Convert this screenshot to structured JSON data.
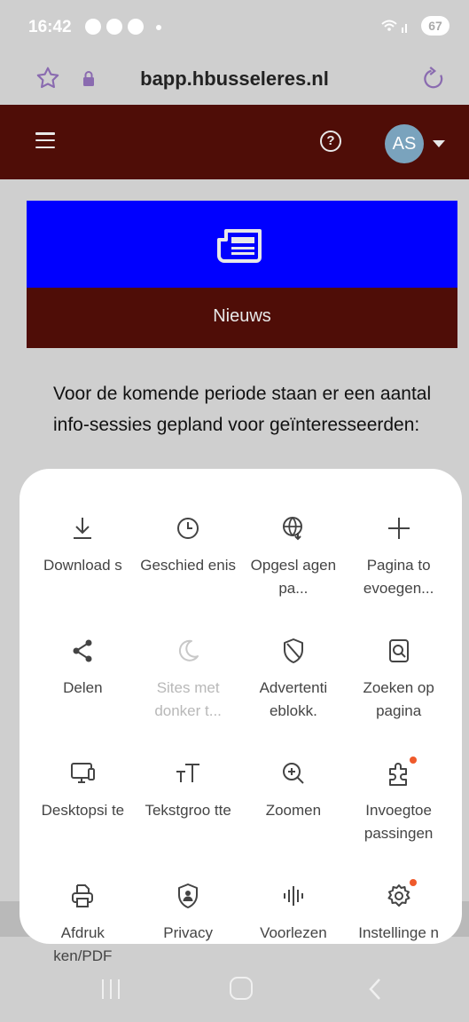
{
  "status": {
    "time": "16:42",
    "battery": "67"
  },
  "browser": {
    "url": "bapp.hbusseleres.nl"
  },
  "header": {
    "avatar_initials": "AS"
  },
  "news": {
    "title": "Nieuws",
    "body": "Voor de komende periode staan er een aantal info-sessies gepland voor geïnteresseerden:"
  },
  "menu": {
    "items": [
      {
        "label": "Download s",
        "icon": "download-icon"
      },
      {
        "label": "Geschied enis",
        "icon": "history-icon"
      },
      {
        "label": "Opgesl agen pa...",
        "icon": "saved-pages-icon"
      },
      {
        "label": "Pagina to evoegen...",
        "icon": "plus-icon"
      },
      {
        "label": "Delen",
        "icon": "share-icon"
      },
      {
        "label": "Sites met donker t...",
        "icon": "moon-icon"
      },
      {
        "label": "Advertenti eblokk.",
        "icon": "shield-icon"
      },
      {
        "label": "Zoeken op pagina",
        "icon": "find-in-page-icon"
      },
      {
        "label": "Desktopsi te",
        "icon": "desktop-icon"
      },
      {
        "label": "Tekstgroo tte",
        "icon": "text-size-icon"
      },
      {
        "label": "Zoomen",
        "icon": "zoom-icon"
      },
      {
        "label": "Invoegtoe passingen",
        "icon": "extensions-icon"
      },
      {
        "label": "Afdruk ken/PDF",
        "icon": "print-icon"
      },
      {
        "label": "Privacy",
        "icon": "privacy-icon"
      },
      {
        "label": "Voorlezen",
        "icon": "read-aloud-icon"
      },
      {
        "label": "Instellinge n",
        "icon": "settings-icon"
      }
    ]
  },
  "colors": {
    "header": "#4f0d07",
    "news_banner": "#0000ff",
    "badge": "#ef5a2b",
    "avatar": "#7aa3bd"
  }
}
